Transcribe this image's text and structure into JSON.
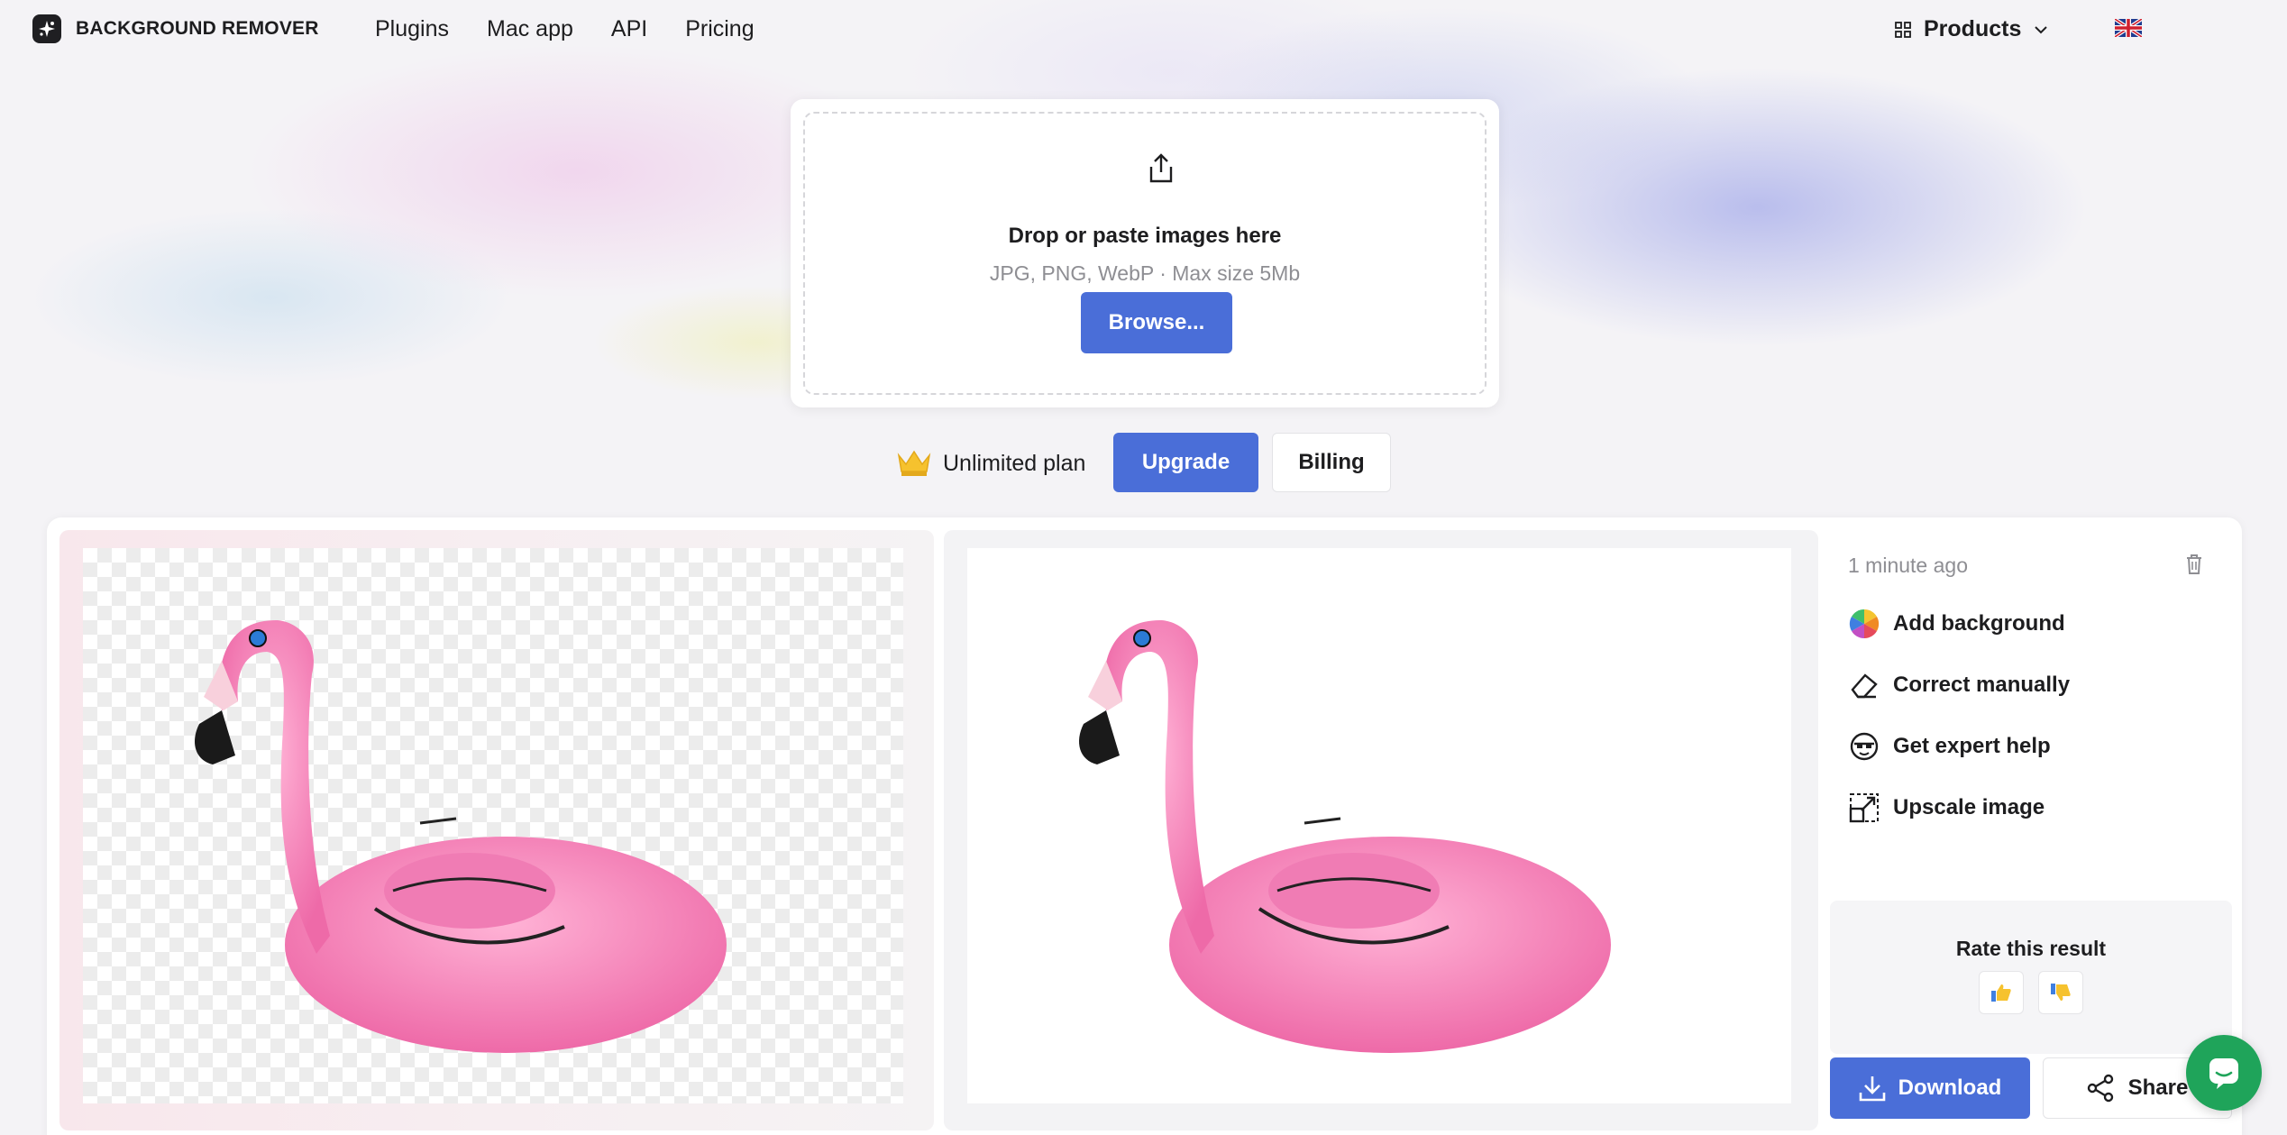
{
  "header": {
    "brand": "BACKGROUND REMOVER",
    "nav": [
      "Plugins",
      "Mac app",
      "API",
      "Pricing"
    ],
    "products_label": "Products",
    "language_icon": "uk-flag-icon"
  },
  "upload": {
    "title": "Drop or paste images here",
    "subtitle": "JPG, PNG, WebP · Max size 5Mb",
    "browse_label": "Browse..."
  },
  "plan": {
    "label": "Unlimited plan",
    "upgrade_label": "Upgrade",
    "billing_label": "Billing"
  },
  "result": {
    "time_ago": "1 minute ago",
    "actions": [
      {
        "label": "Add background",
        "icon": "color-wheel-icon"
      },
      {
        "label": "Correct manually",
        "icon": "eraser-icon"
      },
      {
        "label": "Get expert help",
        "icon": "expert-icon"
      },
      {
        "label": "Upscale image",
        "icon": "upscale-icon"
      }
    ],
    "rate_title": "Rate this result",
    "download_label": "Download",
    "share_label": "Share"
  },
  "colors": {
    "accent": "#4a6ed8",
    "flamingo_pink": "#f27fb8",
    "chat": "#1fa45a"
  }
}
